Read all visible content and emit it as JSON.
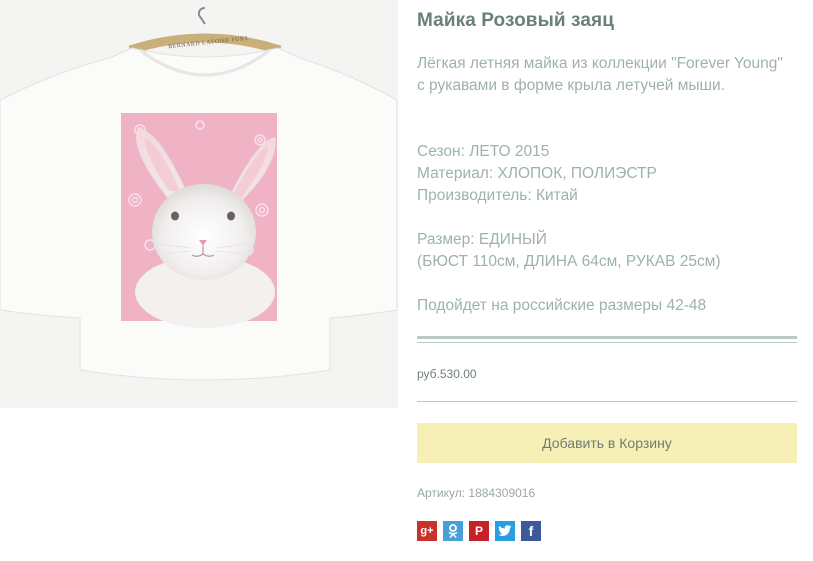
{
  "product": {
    "image_alt": "t-shirt with pink rabbit print",
    "hanger_label": "BERNARD LAFOND FURS",
    "title": "Майка Розовый заяц",
    "description": "Лёгкая летняя майка из коллекции \"Forever Young\" с рукавами в форме крыла летучей мыши.",
    "season": "Сезон: ЛЕТО 2015",
    "material": "Материал: ХЛОПОК, ПОЛИЭСТР",
    "manufacturer": "Производитель: Китай",
    "size": "Размер: ЕДИНЫЙ",
    "measurements": "(БЮСТ 110см, ДЛИНА 64см, РУКАВ 25см)",
    "fit": "Подойдет на российские размеры 42-48",
    "price": "руб.530.00",
    "add_to_cart_label": "Добавить в Корзину",
    "sku": "Артикул: 1884309016"
  },
  "share": {
    "gplus": "g+",
    "odnoklassniki": "ok",
    "pinterest": "P",
    "twitter": "t",
    "facebook": "f"
  },
  "colors": {
    "button_bg": "#f7f0b6",
    "text_muted": "#9db2aa",
    "rule": "#b9c9c3",
    "print_pink": "#f0b3c5"
  }
}
